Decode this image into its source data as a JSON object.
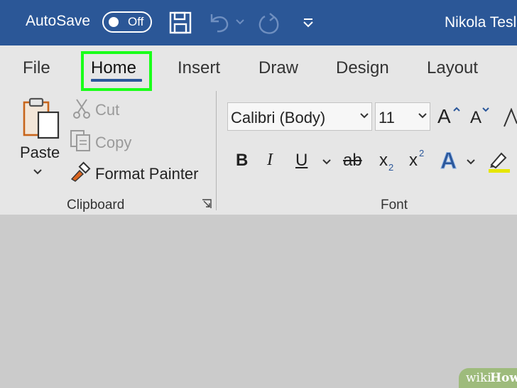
{
  "titlebar": {
    "autosave_label": "AutoSave",
    "autosave_state": "Off",
    "user_name": "Nikola Tesla",
    "bg_color": "#2b5797"
  },
  "tabs": {
    "file": "File",
    "home": "Home",
    "insert": "Insert",
    "draw": "Draw",
    "design": "Design",
    "layout": "Layout",
    "highlight_color": "#1aff1a"
  },
  "clipboard": {
    "paste": "Paste",
    "cut": "Cut",
    "copy": "Copy",
    "format_painter": "Format Painter",
    "group_label": "Clipboard"
  },
  "font": {
    "font_name": "Calibri (Body)",
    "font_size": "11",
    "bold": "B",
    "italic": "I",
    "underline": "U",
    "strike": "ab",
    "subscript": "x",
    "subscript_mark": "2",
    "superscript": "x",
    "superscript_mark": "2",
    "grow_font": "A",
    "shrink_font": "A",
    "text_effects": "A",
    "group_label": "Font"
  },
  "watermark": {
    "wiki": "wiki",
    "how": "How"
  }
}
